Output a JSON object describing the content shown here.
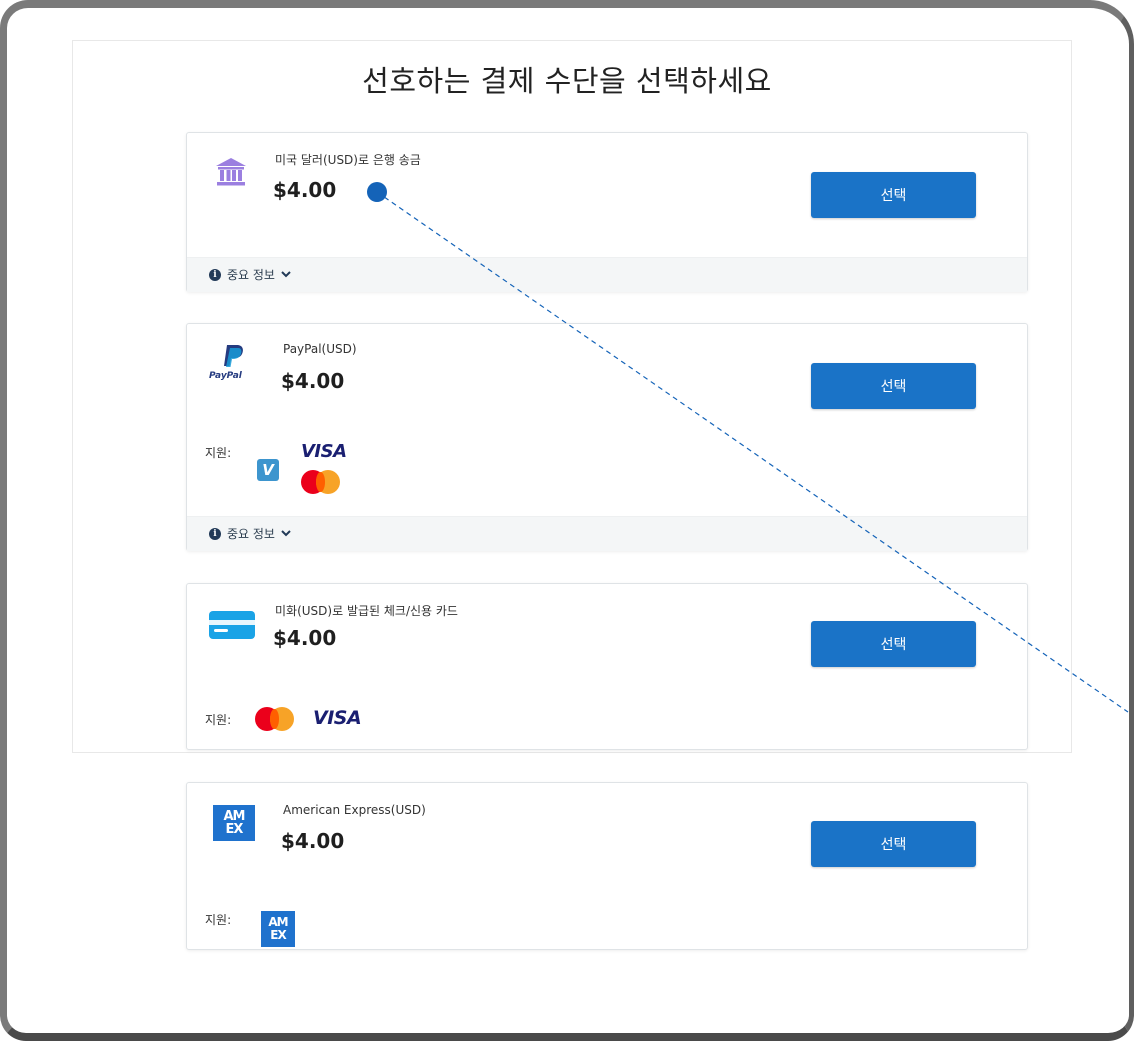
{
  "page": {
    "title": "선호하는 결제 수단을 선택하세요"
  },
  "methods": [
    {
      "label": "미국 달러(USD)로 은행 송금",
      "price": "$4.00",
      "button": "선택",
      "info": "중요 정보",
      "icon": "bank-icon"
    },
    {
      "label": "PayPal(USD)",
      "price": "$4.00",
      "button": "선택",
      "info": "중요 정보",
      "support_label": "지원:",
      "icon": "paypal-icon",
      "paypal_wordmark": "PayPal",
      "brands": [
        "venmo",
        "VISA",
        "mastercard"
      ]
    },
    {
      "label": "미화(USD)로 발급된 체크/신용 카드",
      "price": "$4.00",
      "button": "선택",
      "support_label": "지원:",
      "icon": "credit-card-icon",
      "brands": [
        "mastercard",
        "VISA"
      ]
    },
    {
      "label": "American Express(USD)",
      "price": "$4.00",
      "button": "선택",
      "support_label": "지원:",
      "icon": "amex-icon",
      "brands": [
        "amex"
      ]
    }
  ],
  "brand_text": {
    "visa": "VISA",
    "venmo": "V",
    "amex_top": "AM",
    "amex_bottom": "EX"
  },
  "colors": {
    "button": "#1a73c7",
    "bank_icon": "#9b7fe0",
    "card_icon": "#1aa3e6",
    "amex": "#1f72cd",
    "pointer": "#1463b8"
  }
}
